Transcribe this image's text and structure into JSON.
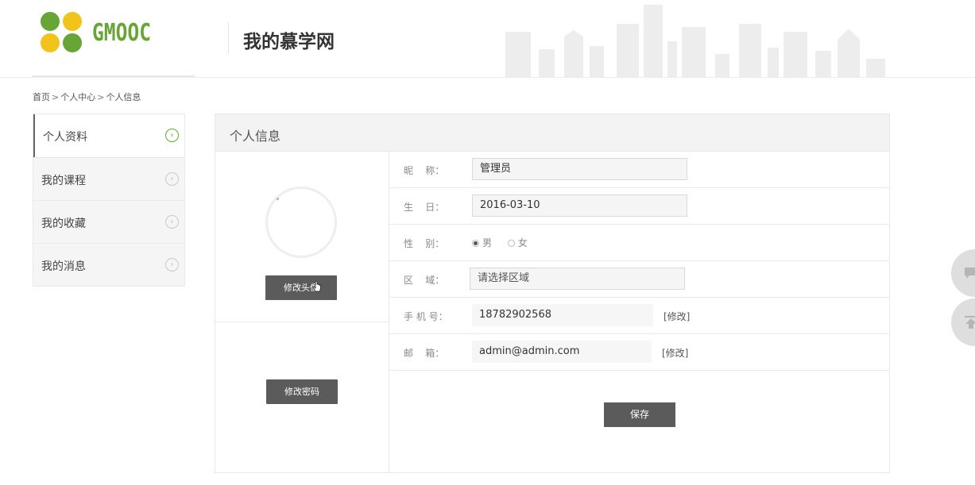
{
  "header": {
    "logo_text": "GMOOC",
    "site_title": "我的慕学网"
  },
  "breadcrumb": {
    "items": [
      "首页",
      "个人中心",
      "个人信息"
    ],
    "separator": ">"
  },
  "sidebar": {
    "items": [
      {
        "label": "个人资料",
        "active": true
      },
      {
        "label": "我的课程",
        "active": false
      },
      {
        "label": "我的收藏",
        "active": false
      },
      {
        "label": "我的消息",
        "active": false
      }
    ],
    "arrow_glyph": "›"
  },
  "panel": {
    "title": "个人信息",
    "avatar_button": "修改头像",
    "password_button": "修改密码"
  },
  "form": {
    "nickname": {
      "label": "昵    称：",
      "value": "管理员"
    },
    "birthday": {
      "label": "生    日：",
      "value": "2016-03-10"
    },
    "gender": {
      "label": "性    别：",
      "options": [
        "男",
        "女"
      ],
      "selected": "男"
    },
    "region": {
      "label": "区    域：",
      "placeholder": "请选择区域"
    },
    "phone": {
      "label": "手 机 号：",
      "value": "18782902568",
      "edit_label": "[修改]"
    },
    "email": {
      "label": "邮    箱：",
      "value": "admin@admin.com",
      "edit_label": "[修改]"
    },
    "save_label": "保存"
  },
  "colors": {
    "brand_green": "#67a534",
    "brand_yellow": "#f2c31b",
    "button_gray": "#5b5b5b"
  },
  "icons": [
    "logo-clover-icon",
    "skyline-graphic",
    "chevron-right-icon",
    "cursor-hand-icon",
    "chat-icon",
    "back-to-top-icon"
  ]
}
